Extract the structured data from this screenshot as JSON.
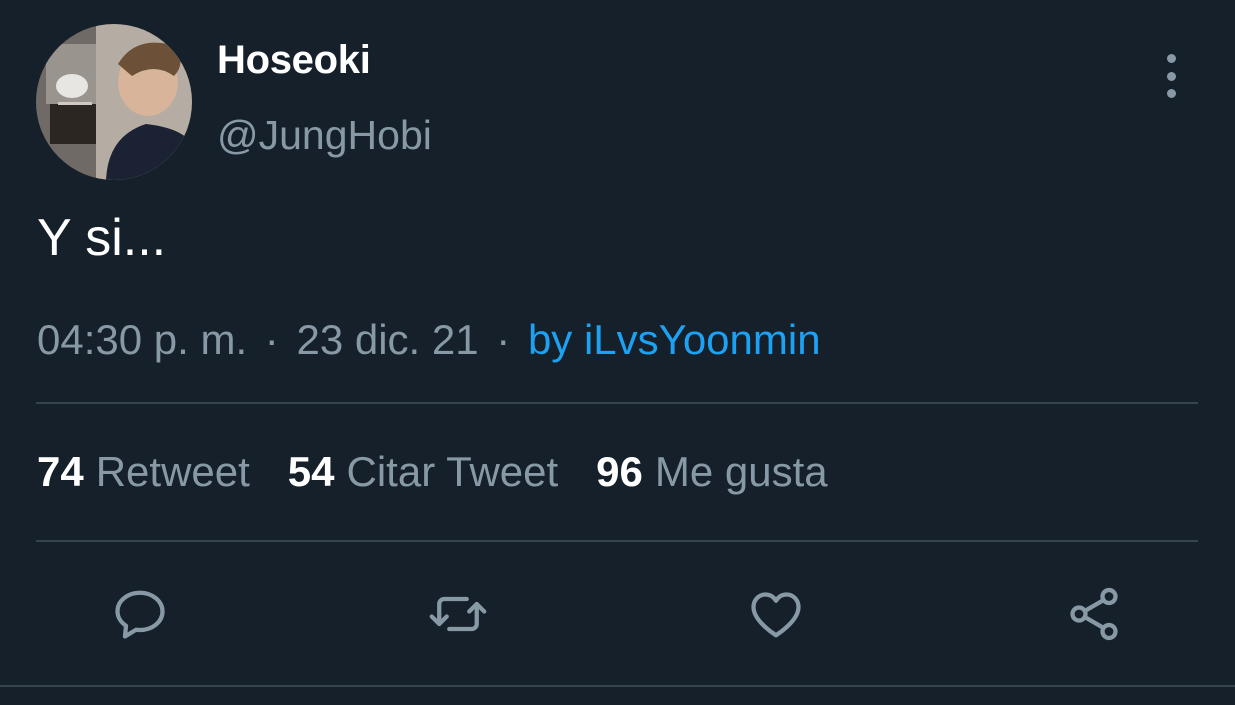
{
  "colors": {
    "background": "#15202b",
    "text_primary": "#ffffff",
    "text_secondary": "#8899a6",
    "link": "#1da1f2",
    "divider": "#38444d"
  },
  "author": {
    "display_name": "Hoseoki",
    "handle": "@JungHobi",
    "avatar_icon": "profile-photo"
  },
  "tweet": {
    "text": "Y si..."
  },
  "meta": {
    "time": "04:30 p. m.",
    "separator1": "·",
    "date": "23 dic. 21",
    "separator2": "·",
    "source": "by iLvsYoonmin"
  },
  "stats": [
    {
      "count": "74",
      "label": "Retweet"
    },
    {
      "count": "54",
      "label": "Citar Tweet"
    },
    {
      "count": "96",
      "label": "Me gusta"
    }
  ],
  "actions": [
    {
      "icon": "reply-icon"
    },
    {
      "icon": "retweet-icon"
    },
    {
      "icon": "like-icon"
    },
    {
      "icon": "share-icon"
    }
  ],
  "menu_icon": "more-vertical-icon"
}
